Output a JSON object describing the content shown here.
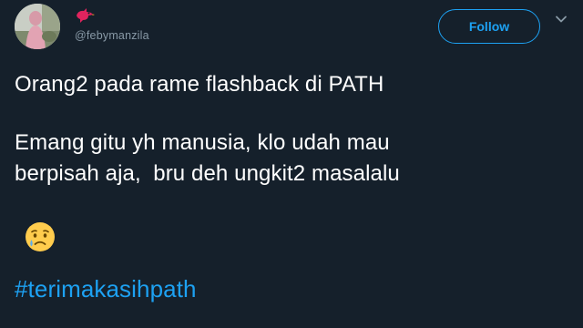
{
  "tweet": {
    "handle": "@febymanzila",
    "follow_label": "Follow",
    "lines": [
      "Orang2 pada rame flashback di PATH",
      "Emang gitu yh manusia, klo udah mau",
      "berpisah aja,  bru deh ungkit2 masalalu"
    ],
    "hashtag": "#terimakasihpath",
    "emoji": "crying-face"
  },
  "colors": {
    "background": "#15202b",
    "accent": "#1da1f2",
    "handle": "#8899a6",
    "bird": "#e0245e"
  }
}
